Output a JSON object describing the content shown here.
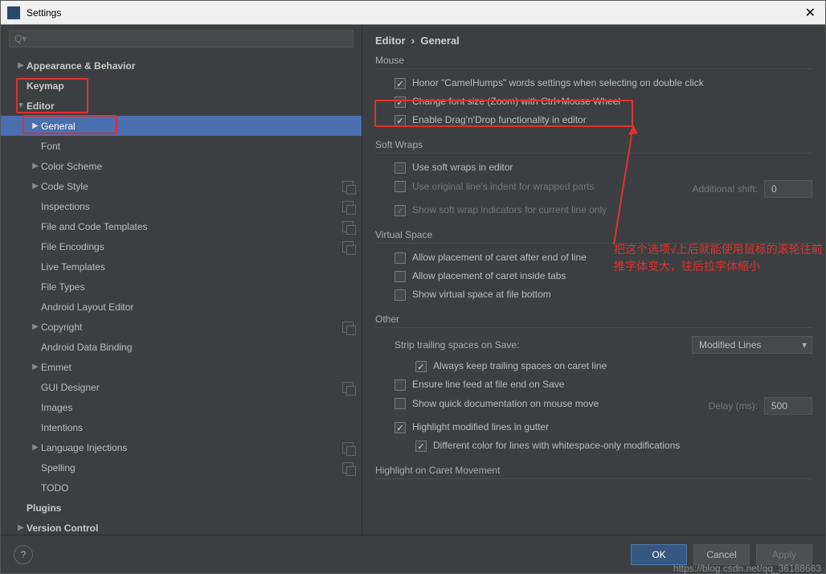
{
  "window": {
    "title": "Settings"
  },
  "search": {
    "placeholder": "Q▾"
  },
  "tree": [
    {
      "label": "Appearance & Behavior",
      "level": 0,
      "arrow": "▶",
      "bold": true
    },
    {
      "label": "Keymap",
      "level": 0,
      "arrow": "",
      "bold": true
    },
    {
      "label": "Editor",
      "level": 0,
      "arrow": "▼",
      "bold": true
    },
    {
      "label": "General",
      "level": 1,
      "arrow": "▶",
      "bold": false,
      "selected": true
    },
    {
      "label": "Font",
      "level": 1,
      "arrow": "",
      "bold": false
    },
    {
      "label": "Color Scheme",
      "level": 1,
      "arrow": "▶",
      "bold": false
    },
    {
      "label": "Code Style",
      "level": 1,
      "arrow": "▶",
      "bold": false,
      "proj": true
    },
    {
      "label": "Inspections",
      "level": 1,
      "arrow": "",
      "bold": false,
      "proj": true
    },
    {
      "label": "File and Code Templates",
      "level": 1,
      "arrow": "",
      "bold": false,
      "proj": true
    },
    {
      "label": "File Encodings",
      "level": 1,
      "arrow": "",
      "bold": false,
      "proj": true
    },
    {
      "label": "Live Templates",
      "level": 1,
      "arrow": "",
      "bold": false
    },
    {
      "label": "File Types",
      "level": 1,
      "arrow": "",
      "bold": false
    },
    {
      "label": "Android Layout Editor",
      "level": 1,
      "arrow": "",
      "bold": false
    },
    {
      "label": "Copyright",
      "level": 1,
      "arrow": "▶",
      "bold": false,
      "proj": true
    },
    {
      "label": "Android Data Binding",
      "level": 1,
      "arrow": "",
      "bold": false
    },
    {
      "label": "Emmet",
      "level": 1,
      "arrow": "▶",
      "bold": false
    },
    {
      "label": "GUI Designer",
      "level": 1,
      "arrow": "",
      "bold": false,
      "proj": true
    },
    {
      "label": "Images",
      "level": 1,
      "arrow": "",
      "bold": false
    },
    {
      "label": "Intentions",
      "level": 1,
      "arrow": "",
      "bold": false
    },
    {
      "label": "Language Injections",
      "level": 1,
      "arrow": "▶",
      "bold": false,
      "proj": true
    },
    {
      "label": "Spelling",
      "level": 1,
      "arrow": "",
      "bold": false,
      "proj": true
    },
    {
      "label": "TODO",
      "level": 1,
      "arrow": "",
      "bold": false
    },
    {
      "label": "Plugins",
      "level": 0,
      "arrow": "",
      "bold": true
    },
    {
      "label": "Version Control",
      "level": 0,
      "arrow": "▶",
      "bold": true
    }
  ],
  "breadcrumb": {
    "part1": "Editor",
    "sep": "›",
    "part2": "General"
  },
  "sections": {
    "mouse": "Mouse",
    "softwraps": "Soft Wraps",
    "virtual": "Virtual Space",
    "other": "Other",
    "highlight": "Highlight on Caret Movement"
  },
  "mouse_opts": {
    "camelhumps": {
      "label": "Honor \"CamelHumps\" words settings when selecting on double click",
      "checked": true
    },
    "zoom": {
      "label": "Change font size (Zoom) with Ctrl+Mouse Wheel",
      "checked": true
    },
    "dnd": {
      "label": "Enable Drag'n'Drop functionality in editor",
      "checked": true
    }
  },
  "softwrap_opts": {
    "use": {
      "label": "Use soft wraps in editor",
      "checked": false
    },
    "indent": {
      "label": "Use original line's indent for wrapped parts",
      "checked": false
    },
    "shift_label": "Additional shift:",
    "shift_value": "0",
    "show": {
      "label": "Show soft wrap indicators for current line only",
      "checked": true
    }
  },
  "virtual_opts": {
    "eol": {
      "label": "Allow placement of caret after end of line",
      "checked": false
    },
    "tabs": {
      "label": "Allow placement of caret inside tabs",
      "checked": false
    },
    "bottom": {
      "label": "Show virtual space at file bottom",
      "checked": false
    }
  },
  "other_opts": {
    "strip_label": "Strip trailing spaces on Save:",
    "strip_value": "Modified Lines",
    "keep_caret": {
      "label": "Always keep trailing spaces on caret line",
      "checked": true
    },
    "ensure_lf": {
      "label": "Ensure line feed at file end on Save",
      "checked": false
    },
    "quickdoc": {
      "label": "Show quick documentation on mouse move",
      "checked": false
    },
    "delay_label": "Delay (ms):",
    "delay_value": "500",
    "highlight_mod": {
      "label": "Highlight modified lines in gutter",
      "checked": true
    },
    "diff_color": {
      "label": "Different color for lines with whitespace-only modifications",
      "checked": true
    }
  },
  "annotation": "把这个选项√上后就能使用鼠标的滚轮往前推字体变大，往后拉字体缩小",
  "buttons": {
    "ok": "OK",
    "cancel": "Cancel",
    "apply": "Apply",
    "help": "?"
  },
  "watermark": "https://blog.csdn.net/qq_36188663"
}
